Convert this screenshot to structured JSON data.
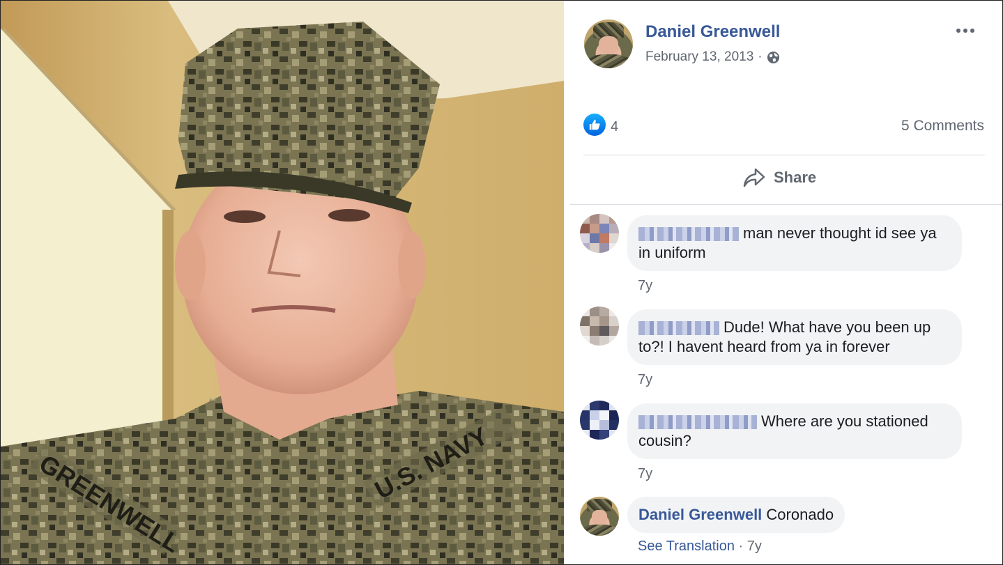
{
  "post": {
    "author": "Daniel Greenwell",
    "date": "February 13, 2013",
    "separator": "·",
    "privacy_icon": "globe-icon",
    "more_icon": "more-options-icon",
    "photo_text": {
      "name_tape": "GREENWELL",
      "service_tape": "U.S. NAVY"
    }
  },
  "stats": {
    "like_icon": "thumbs-up-icon",
    "likes": "4",
    "comments": "5 Comments"
  },
  "actions": {
    "share_icon": "share-arrow-icon",
    "share_label": "Share"
  },
  "comments": [
    {
      "text": "man never thought id see ya in uniform",
      "time": "7y"
    },
    {
      "text": "Dude! What have you been up to?! I havent heard from ya in forever",
      "time": "7y"
    },
    {
      "text": "Where are you stationed cousin?",
      "time": "7y"
    }
  ],
  "reply": {
    "author": "Daniel Greenwell",
    "text": "Coronado",
    "see_translation": "See Translation",
    "separator": "·",
    "time": "7y"
  },
  "colors": {
    "link_blue": "#385898",
    "like_blue": "#1877f2",
    "secondary_text": "#606770",
    "bubble_bg": "#f2f3f5",
    "divider": "#dadde1"
  }
}
